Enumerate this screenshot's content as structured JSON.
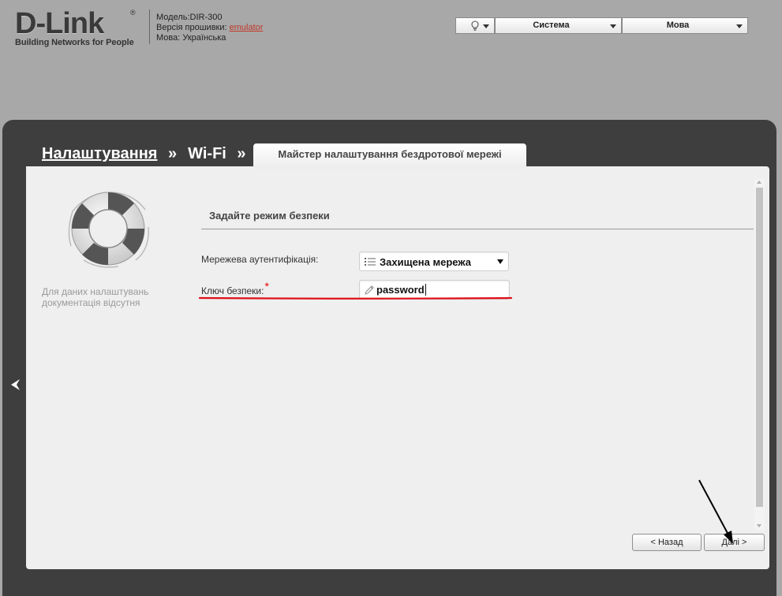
{
  "header": {
    "logo_text": "D-Link",
    "logo_reg": "®",
    "logo_tagline": "Building Networks for People",
    "model": "Модель:DIR-300",
    "firmware_label": "Версія прошивки:",
    "firmware_value": "emulator",
    "language_info": "Мова: Українська"
  },
  "topmenu": {
    "bulb_icon": "lightbulb-icon",
    "system_label": "Система",
    "language_label": "Мова"
  },
  "breadcrumb": {
    "item1": "Налаштування",
    "sep": "»",
    "item2": "Wi-Fi"
  },
  "tab": {
    "label": "Майстер налаштування бездротової мережі"
  },
  "sidebar": {
    "icon": "lifebuoy-icon",
    "no_docs": "Для даних налаштувань документація відсутня"
  },
  "form": {
    "section_title": "Задайте режим безпеки",
    "auth_label": "Мережева аутентифікація:",
    "auth_value": "Захищена мережа",
    "key_label": "Ключ безпеки:",
    "key_required": "*",
    "key_value": "password"
  },
  "buttons": {
    "back": "< Назад",
    "next": "Далі >"
  },
  "colors": {
    "frame": "#3e3e3e",
    "panel": "#efefef",
    "background": "#a8a8a8",
    "annotation_red": "#e0101a"
  }
}
